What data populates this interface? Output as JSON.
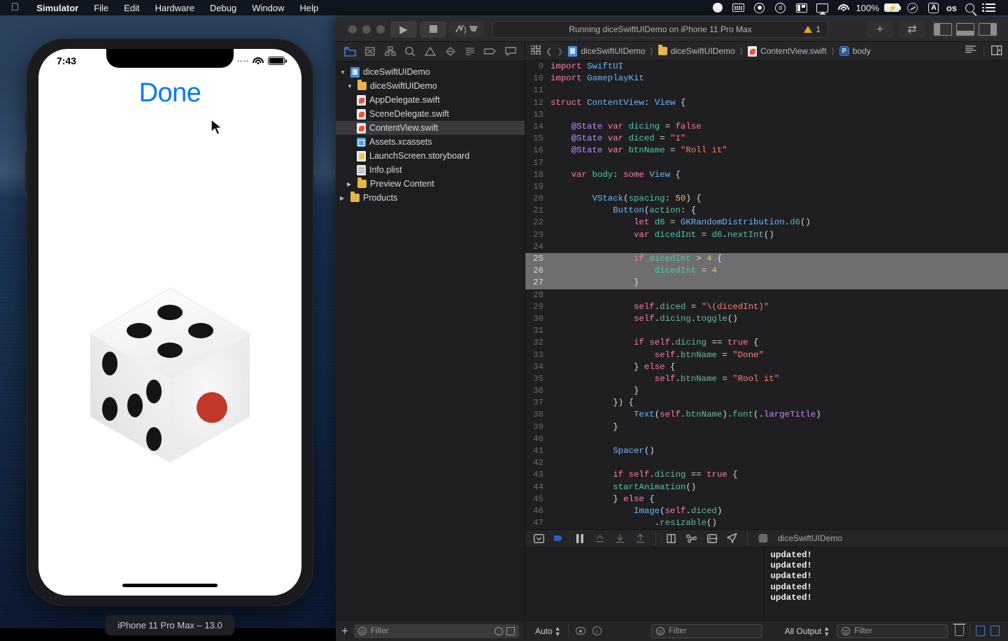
{
  "menubar": {
    "apple_icon": "apple-logo-icon",
    "items": [
      {
        "label": "Simulator",
        "bold": true
      },
      {
        "label": "File",
        "bold": false
      },
      {
        "label": "Edit",
        "bold": false
      },
      {
        "label": "Hardware",
        "bold": false
      },
      {
        "label": "Debug",
        "bold": false
      },
      {
        "label": "Window",
        "bold": false
      },
      {
        "label": "Help",
        "bold": false
      }
    ],
    "status_icons": [
      "record-icon",
      "keyboard-icon",
      "screen-record-icon",
      "dropbox-icon",
      "split-view-icon",
      "airplay-icon",
      "wifi-icon"
    ],
    "battery_percent": "100%",
    "right_icons": [
      "battery-charging-icon",
      "compass-icon",
      "input-source-icon",
      "os-label",
      "spotlight-search-icon",
      "control-center-icon"
    ],
    "input_source": "A",
    "os_label": "os"
  },
  "simulator": {
    "status_time": "7:43",
    "button_label": "Done",
    "button_color": "#007aff",
    "device_label": "iPhone 11 Pro Max – 13.0",
    "dice": {
      "top_face_pips": 4,
      "right_face_pips": 1,
      "right_pip_color": "#c0392b",
      "left_face_pips": 5,
      "pip_color": "#111111"
    }
  },
  "xcode": {
    "toolbar": {
      "run_label": "run-button",
      "stop_label": "stop-button",
      "scheme": "diceSwiftUIDemo",
      "status_text": "Running diceSwiftUIDemo on iPhone 11 Pro Max",
      "warning_count": "1",
      "add_label": "+",
      "panel_icons": [
        "navigator-toggle-icon",
        "debug-area-toggle-icon",
        "inspector-toggle-icon"
      ]
    },
    "navigator": {
      "tabs": [
        "project-navigator-icon",
        "source-control-icon",
        "symbol-navigator-icon",
        "find-navigator-icon",
        "issue-navigator-icon",
        "test-navigator-icon",
        "debug-navigator-icon",
        "breakpoint-navigator-icon",
        "report-navigator-icon"
      ],
      "active_tab": 0,
      "tree": [
        {
          "label": "diceSwiftUIDemo",
          "indent": 0,
          "icon": "proj",
          "arrow": "down",
          "selected": false
        },
        {
          "label": "diceSwiftUIDemo",
          "indent": 1,
          "icon": "folder",
          "arrow": "down",
          "selected": false
        },
        {
          "label": "AppDelegate.swift",
          "indent": 2,
          "icon": "swift",
          "arrow": "",
          "selected": false
        },
        {
          "label": "SceneDelegate.swift",
          "indent": 2,
          "icon": "swift",
          "arrow": "",
          "selected": false
        },
        {
          "label": "ContentView.swift",
          "indent": 2,
          "icon": "swift",
          "arrow": "",
          "selected": true
        },
        {
          "label": "Assets.xcassets",
          "indent": 2,
          "icon": "assets",
          "arrow": "",
          "selected": false
        },
        {
          "label": "LaunchScreen.storyboard",
          "indent": 2,
          "icon": "story",
          "arrow": "",
          "selected": false
        },
        {
          "label": "Info.plist",
          "indent": 2,
          "icon": "plist",
          "arrow": "",
          "selected": false
        },
        {
          "label": "Preview Content",
          "indent": 1,
          "icon": "folder",
          "arrow": "right",
          "selected": false
        },
        {
          "label": "Products",
          "indent": 0,
          "icon": "folder",
          "arrow": "right",
          "selected": false
        }
      ],
      "add_button": "+",
      "filter_placeholder": "Filter"
    },
    "jumpbar": {
      "crumbs": [
        "diceSwiftUIDemo",
        "diceSwiftUIDemo",
        "ContentView.swift",
        "body"
      ],
      "back_icon": "chevron-left-icon",
      "forward_icon": "chevron-right-icon"
    },
    "code": {
      "first_line": 9,
      "highlighted_lines": [
        25,
        26,
        27
      ],
      "lines": [
        {
          "n": 9,
          "t": "import SwiftUI"
        },
        {
          "n": 10,
          "t": "import GameplayKit"
        },
        {
          "n": 11,
          "t": ""
        },
        {
          "n": 12,
          "t": "struct ContentView: View {"
        },
        {
          "n": 13,
          "t": ""
        },
        {
          "n": 14,
          "t": "    @State var dicing = false"
        },
        {
          "n": 15,
          "t": "    @State var diced = \"1\""
        },
        {
          "n": 16,
          "t": "    @State var btnName = \"Roll it\""
        },
        {
          "n": 17,
          "t": ""
        },
        {
          "n": 18,
          "t": "    var body: some View {"
        },
        {
          "n": 19,
          "t": ""
        },
        {
          "n": 20,
          "t": "        VStack(spacing: 50) {"
        },
        {
          "n": 21,
          "t": "            Button(action: {"
        },
        {
          "n": 22,
          "t": "                let d6 = GKRandomDistribution.d6()"
        },
        {
          "n": 23,
          "t": "                var dicedInt = d6.nextInt()"
        },
        {
          "n": 24,
          "t": ""
        },
        {
          "n": 25,
          "t": "                if dicedInt > 4 {"
        },
        {
          "n": 26,
          "t": "                    dicedInt = 4"
        },
        {
          "n": 27,
          "t": "                }"
        },
        {
          "n": 28,
          "t": ""
        },
        {
          "n": 29,
          "t": "                self.diced = \"\\(dicedInt)\""
        },
        {
          "n": 30,
          "t": "                self.dicing.toggle()"
        },
        {
          "n": 31,
          "t": ""
        },
        {
          "n": 32,
          "t": "                if self.dicing == true {"
        },
        {
          "n": 33,
          "t": "                    self.btnName = \"Done\""
        },
        {
          "n": 34,
          "t": "                } else {"
        },
        {
          "n": 35,
          "t": "                    self.btnName = \"Rool it\""
        },
        {
          "n": 36,
          "t": "                }"
        },
        {
          "n": 37,
          "t": "            }) {"
        },
        {
          "n": 38,
          "t": "                Text(self.btnName).font(.largeTitle)"
        },
        {
          "n": 39,
          "t": "            }"
        },
        {
          "n": 40,
          "t": ""
        },
        {
          "n": 41,
          "t": "            Spacer()"
        },
        {
          "n": 42,
          "t": ""
        },
        {
          "n": 43,
          "t": "            if self.dicing == true {"
        },
        {
          "n": 44,
          "t": "            startAnimation()"
        },
        {
          "n": 45,
          "t": "            } else {"
        },
        {
          "n": 46,
          "t": "                Image(self.diced)"
        },
        {
          "n": 47,
          "t": "                    .resizable()"
        }
      ]
    },
    "debugbar": {
      "icons": [
        "hide-debug-icon",
        "continue-icon",
        "pause-icon",
        "step-over-icon",
        "step-into-icon",
        "step-out-icon",
        "view-hierarchy-icon",
        "memory-graph-icon",
        "environment-overrides-icon",
        "location-simulate-icon"
      ],
      "process_name": "diceSwiftUIDemo"
    },
    "console": {
      "lines": [
        "updated!",
        "updated!",
        "updated!",
        "updated!",
        "updated!"
      ]
    },
    "bottombar": {
      "auto_label": "Auto",
      "variables_filter_placeholder": "Filter",
      "output_label": "All Output",
      "console_filter_placeholder": "Filter",
      "trash_icon": "clear-console-icon",
      "split_icons": [
        "show-variables-icon",
        "show-console-icon"
      ]
    }
  }
}
